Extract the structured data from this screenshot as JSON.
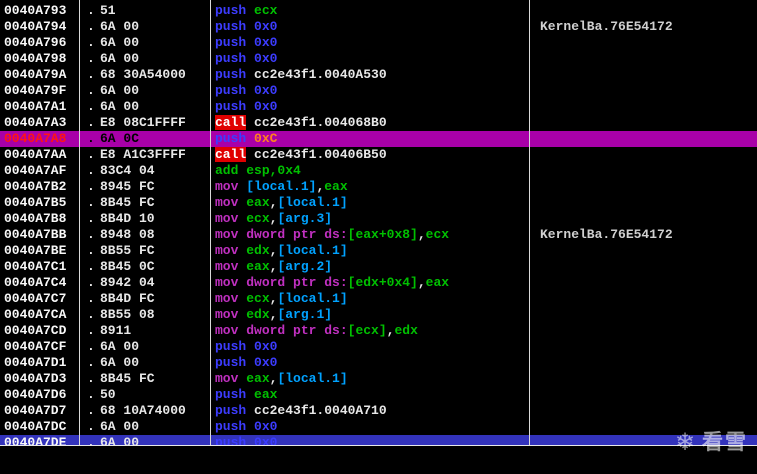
{
  "palette": {
    "background": "#000000",
    "address": "#F8F8F8",
    "white": "#E8E8E8",
    "blue": "#3C3CFF",
    "green": "#00C000",
    "magenta": "#C030C0",
    "cyan": "#00A2FF",
    "orange": "#FF8020",
    "red": "#FF1414",
    "black": "#000000",
    "comment": "#D0D0D0",
    "call_fg": "#FFFFFF",
    "call_bg": "#E00000",
    "eip_row_bg": "#A800A8",
    "selected_row_bg": "#3333BB",
    "separator": "#DADADA"
  },
  "row_prefix": ".",
  "watermark": {
    "icon": "snowflake-icon",
    "text": "看雪"
  },
  "rows": [
    {
      "address": "0040A793",
      "bytes": "51",
      "ins": [
        [
          "push ",
          "blue"
        ],
        [
          "ecx",
          "green"
        ]
      ],
      "comment": ""
    },
    {
      "address": "0040A794",
      "bytes": "6A 00",
      "ins": [
        [
          "push ",
          "blue"
        ],
        [
          "0x0",
          "blue"
        ]
      ],
      "comment": "KernelBa.76E54172"
    },
    {
      "address": "0040A796",
      "bytes": "6A 00",
      "ins": [
        [
          "push ",
          "blue"
        ],
        [
          "0x0",
          "blue"
        ]
      ],
      "comment": ""
    },
    {
      "address": "0040A798",
      "bytes": "6A 00",
      "ins": [
        [
          "push ",
          "blue"
        ],
        [
          "0x0",
          "blue"
        ]
      ],
      "comment": ""
    },
    {
      "address": "0040A79A",
      "bytes": "68 30A54000",
      "ins": [
        [
          "push ",
          "blue"
        ],
        [
          "cc2e43f1.0040A530",
          "white"
        ]
      ],
      "comment": ""
    },
    {
      "address": "0040A79F",
      "bytes": "6A 00",
      "ins": [
        [
          "push ",
          "blue"
        ],
        [
          "0x0",
          "blue"
        ]
      ],
      "comment": ""
    },
    {
      "address": "0040A7A1",
      "bytes": "6A 00",
      "ins": [
        [
          "push ",
          "blue"
        ],
        [
          "0x0",
          "blue"
        ]
      ],
      "comment": ""
    },
    {
      "address": "0040A7A3",
      "bytes": "E8 08C1FFFF",
      "ins": [
        [
          "call",
          "call"
        ],
        [
          " ",
          "white"
        ],
        [
          "cc2e43f1.004068B0",
          "white"
        ]
      ],
      "comment": ""
    },
    {
      "address": "0040A7A8",
      "bytes": "6A 0C",
      "ins": [
        [
          "push ",
          "blue"
        ],
        [
          "0xC",
          "orange"
        ]
      ],
      "comment": "",
      "state": "eip"
    },
    {
      "address": "0040A7AA",
      "bytes": "E8 A1C3FFFF",
      "ins": [
        [
          "call",
          "call"
        ],
        [
          " ",
          "white"
        ],
        [
          "cc2e43f1.00406B50",
          "white"
        ]
      ],
      "comment": ""
    },
    {
      "address": "0040A7AF",
      "bytes": "83C4 04",
      "ins": [
        [
          "add ",
          "green"
        ],
        [
          "esp,0x4",
          "green"
        ]
      ],
      "comment": ""
    },
    {
      "address": "0040A7B2",
      "bytes": "8945 FC",
      "ins": [
        [
          "mov ",
          "magenta"
        ],
        [
          "[local.1]",
          "cyan"
        ],
        [
          ",",
          "white"
        ],
        [
          "eax",
          "green"
        ]
      ],
      "comment": ""
    },
    {
      "address": "0040A7B5",
      "bytes": "8B45 FC",
      "ins": [
        [
          "mov ",
          "magenta"
        ],
        [
          "eax",
          "green"
        ],
        [
          ",",
          "white"
        ],
        [
          "[local.1]",
          "cyan"
        ]
      ],
      "comment": ""
    },
    {
      "address": "0040A7B8",
      "bytes": "8B4D 10",
      "ins": [
        [
          "mov ",
          "magenta"
        ],
        [
          "ecx",
          "green"
        ],
        [
          ",",
          "white"
        ],
        [
          "[arg.3]",
          "cyan"
        ]
      ],
      "comment": ""
    },
    {
      "address": "0040A7BB",
      "bytes": "8948 08",
      "ins": [
        [
          "mov ",
          "magenta"
        ],
        [
          "dword ptr ds:",
          "magenta"
        ],
        [
          "[eax+0x8]",
          "green"
        ],
        [
          ",",
          "white"
        ],
        [
          "ecx",
          "green"
        ]
      ],
      "comment": "KernelBa.76E54172"
    },
    {
      "address": "0040A7BE",
      "bytes": "8B55 FC",
      "ins": [
        [
          "mov ",
          "magenta"
        ],
        [
          "edx",
          "green"
        ],
        [
          ",",
          "white"
        ],
        [
          "[local.1]",
          "cyan"
        ]
      ],
      "comment": ""
    },
    {
      "address": "0040A7C1",
      "bytes": "8B45 0C",
      "ins": [
        [
          "mov ",
          "magenta"
        ],
        [
          "eax",
          "green"
        ],
        [
          ",",
          "white"
        ],
        [
          "[arg.2]",
          "cyan"
        ]
      ],
      "comment": ""
    },
    {
      "address": "0040A7C4",
      "bytes": "8942 04",
      "ins": [
        [
          "mov ",
          "magenta"
        ],
        [
          "dword ptr ds:",
          "magenta"
        ],
        [
          "[edx+0x4]",
          "green"
        ],
        [
          ",",
          "white"
        ],
        [
          "eax",
          "green"
        ]
      ],
      "comment": ""
    },
    {
      "address": "0040A7C7",
      "bytes": "8B4D FC",
      "ins": [
        [
          "mov ",
          "magenta"
        ],
        [
          "ecx",
          "green"
        ],
        [
          ",",
          "white"
        ],
        [
          "[local.1]",
          "cyan"
        ]
      ],
      "comment": ""
    },
    {
      "address": "0040A7CA",
      "bytes": "8B55 08",
      "ins": [
        [
          "mov ",
          "magenta"
        ],
        [
          "edx",
          "green"
        ],
        [
          ",",
          "white"
        ],
        [
          "[arg.1]",
          "cyan"
        ]
      ],
      "comment": ""
    },
    {
      "address": "0040A7CD",
      "bytes": "8911",
      "ins": [
        [
          "mov ",
          "magenta"
        ],
        [
          "dword ptr ds:",
          "magenta"
        ],
        [
          "[ecx]",
          "green"
        ],
        [
          ",",
          "white"
        ],
        [
          "edx",
          "green"
        ]
      ],
      "comment": ""
    },
    {
      "address": "0040A7CF",
      "bytes": "6A 00",
      "ins": [
        [
          "push ",
          "blue"
        ],
        [
          "0x0",
          "blue"
        ]
      ],
      "comment": ""
    },
    {
      "address": "0040A7D1",
      "bytes": "6A 00",
      "ins": [
        [
          "push ",
          "blue"
        ],
        [
          "0x0",
          "blue"
        ]
      ],
      "comment": ""
    },
    {
      "address": "0040A7D3",
      "bytes": "8B45 FC",
      "ins": [
        [
          "mov ",
          "magenta"
        ],
        [
          "eax",
          "green"
        ],
        [
          ",",
          "white"
        ],
        [
          "[local.1]",
          "cyan"
        ]
      ],
      "comment": ""
    },
    {
      "address": "0040A7D6",
      "bytes": "50",
      "ins": [
        [
          "push ",
          "blue"
        ],
        [
          "eax",
          "green"
        ]
      ],
      "comment": ""
    },
    {
      "address": "0040A7D7",
      "bytes": "68 10A74000",
      "ins": [
        [
          "push ",
          "blue"
        ],
        [
          "cc2e43f1.0040A710",
          "white"
        ]
      ],
      "comment": ""
    },
    {
      "address": "0040A7DC",
      "bytes": "6A 00",
      "ins": [
        [
          "push ",
          "blue"
        ],
        [
          "0x0",
          "blue"
        ]
      ],
      "comment": ""
    },
    {
      "address": "0040A7DE",
      "bytes": "6A 00",
      "ins": [
        [
          "push ",
          "blue"
        ],
        [
          "0x0",
          "blue"
        ]
      ],
      "comment": "",
      "state": "selected"
    }
  ]
}
